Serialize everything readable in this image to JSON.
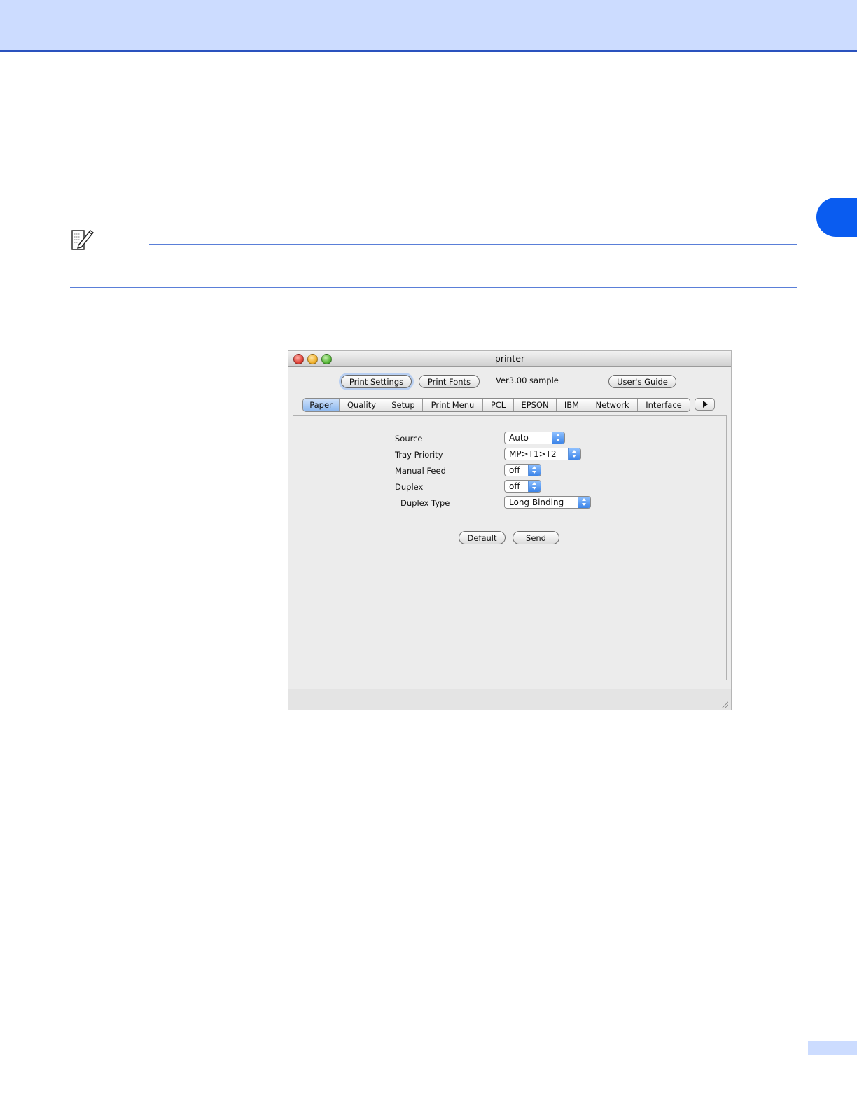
{
  "window": {
    "title": "printer",
    "toolbar": {
      "print_settings": "Print Settings",
      "print_fonts": "Print Fonts",
      "version": "Ver3.00 sample",
      "users_guide": "User's Guide"
    },
    "tabs": [
      "Paper",
      "Quality",
      "Setup",
      "Print Menu",
      "PCL",
      "EPSON",
      "IBM",
      "Network",
      "Interface"
    ],
    "active_tab": "Paper",
    "settings": [
      {
        "label": "Source",
        "value": "Auto"
      },
      {
        "label": "Tray Priority",
        "value": "MP>T1>T2"
      },
      {
        "label": "Manual Feed",
        "value": "off"
      },
      {
        "label": "Duplex",
        "value": "off"
      },
      {
        "label": "Duplex Type",
        "value": "Long Binding"
      }
    ],
    "buttons": {
      "default": "Default",
      "send": "Send"
    }
  },
  "colors": {
    "header_band": "#ccdcff",
    "accent_blue": "#0a5cf0",
    "rule_blue": "#5a7fd8"
  },
  "icons": [
    "note-pencil-icon",
    "close-icon",
    "minimize-icon",
    "zoom-icon",
    "tab-scroll-right-icon",
    "resize-grip-icon"
  ]
}
